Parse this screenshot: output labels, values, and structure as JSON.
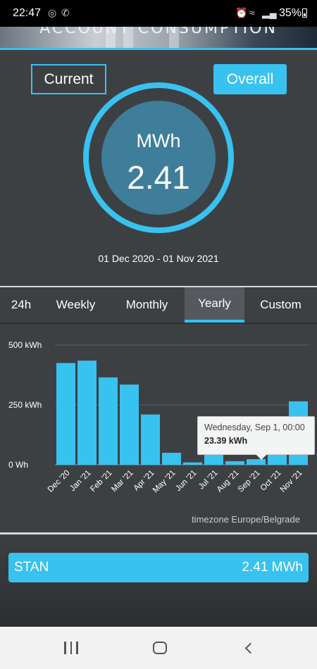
{
  "status_bar": {
    "time": "22:47",
    "battery": "35%",
    "icons": [
      "data-saver-icon",
      "viber-icon",
      "alarm-icon",
      "wifi-icon",
      "signal-icon",
      "battery-icon"
    ]
  },
  "banner": {
    "title": "ACCOUNT CONSUMPTION"
  },
  "summary": {
    "current_label": "Current",
    "overall_label": "Overall",
    "unit": "MWh",
    "value": "2.41",
    "date_range": "01 Dec 2020 - 01 Nov 2021"
  },
  "tabs": [
    {
      "label": "24h",
      "active": false
    },
    {
      "label": "Weekly",
      "active": false
    },
    {
      "label": "Monthly",
      "active": false
    },
    {
      "label": "Yearly",
      "active": true
    },
    {
      "label": "Custom",
      "active": false
    }
  ],
  "chart": {
    "tooltip": {
      "date": "Wednesday, Sep 1, 00:00",
      "value": "23.39 kWh"
    },
    "timezone": "timezone Europe/Belgrade"
  },
  "chart_data": {
    "type": "bar",
    "categories": [
      "Dec '20",
      "Jan '21",
      "Feb '21",
      "Mar '21",
      "Apr '21",
      "May '21",
      "Jun '21",
      "Jul '21",
      "Aug '21",
      "Sep '21",
      "Oct '21",
      "Nov '21"
    ],
    "values": [
      425,
      435,
      365,
      335,
      210,
      50,
      10,
      70,
      15,
      23.39,
      190,
      265
    ],
    "y_ticks": [
      "0 Wh",
      "250 kWh",
      "500 kWh"
    ],
    "ylim": [
      0,
      500
    ],
    "unit": "kWh",
    "grid": true,
    "bar_color": "#38c2ef",
    "highlight_index": 9
  },
  "footer": {
    "label": "STAN",
    "value": "2.41 MWh"
  },
  "colors": {
    "accent": "#38c2ef",
    "background": "#3d4043",
    "ring_inner": "#3e7e9a"
  }
}
